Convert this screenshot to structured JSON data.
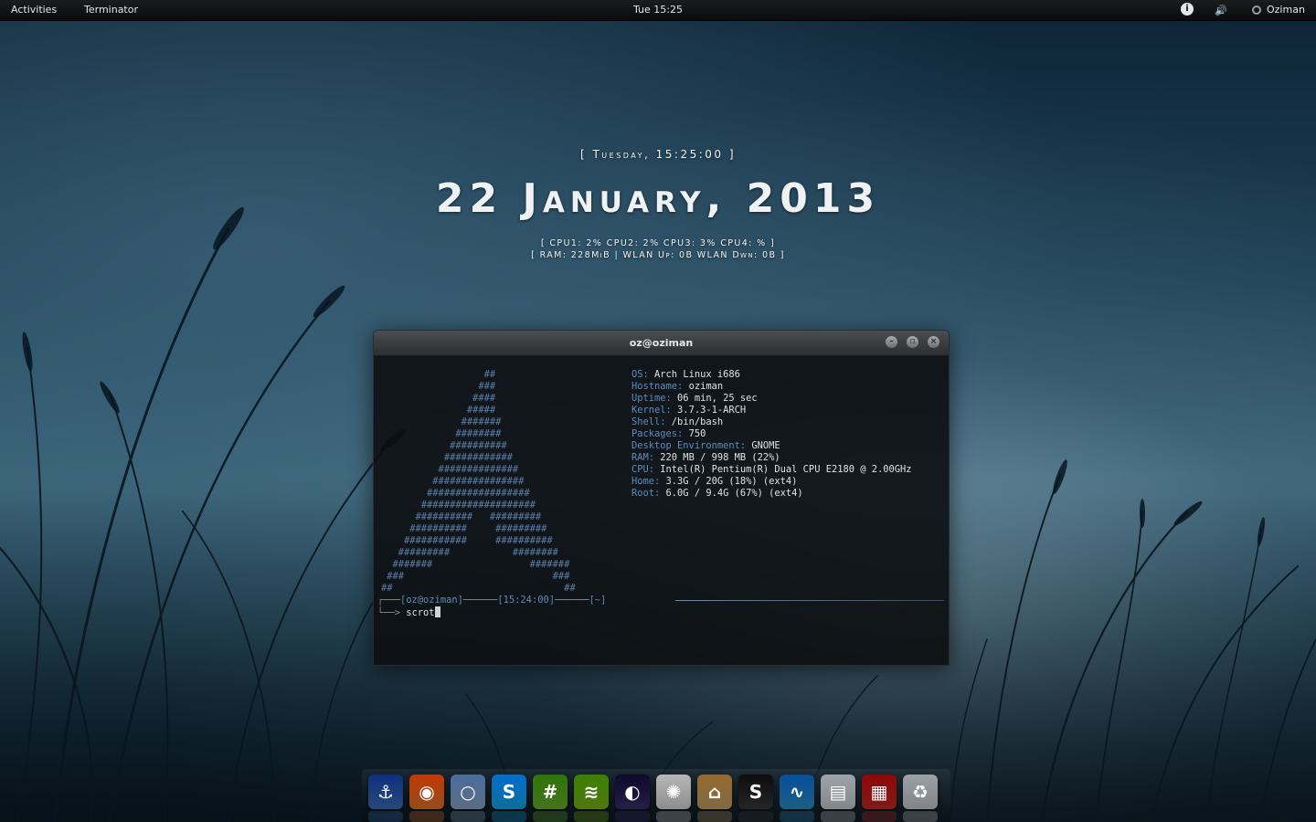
{
  "topbar": {
    "activities": "Activities",
    "app_name": "Terminator",
    "clock": "Tue 15:25",
    "accessibility_glyph": "i",
    "volume_glyph": "🔊",
    "user_name": "Oziman"
  },
  "conky": {
    "day_line": "[ Tuesday, 15:25:00 ]",
    "date_line": "22 January, 2013",
    "cpu_line": "[ CPU1: 2% CPU2: 2% CPU3: 3% CPU4: % ]",
    "net_line": "[ RAM: 228MiB | WLAN Up: 0B    WLAN Dwn: 0B   ]"
  },
  "terminal": {
    "title": "oz@oziman",
    "buttons": {
      "minimize": "–",
      "maximize": "▫",
      "close": "×"
    },
    "logo": "                  ##\n                 ###\n                ####\n               #####\n              #######\n             ########\n            ##########\n           ############\n          ##############\n         ################\n        ##################\n       ####################\n      ##########   #########\n     ##########     #########\n    ###########     ##########\n   #########           ########\n  #######                 #######\n ###                          ###\n##                              ##",
    "info": [
      {
        "key": "OS:",
        "value": " Arch Linux i686"
      },
      {
        "key": "Hostname:",
        "value": " oziman"
      },
      {
        "key": "Uptime:",
        "value": " 06 min, 25 sec"
      },
      {
        "key": "Kernel:",
        "value": " 3.7.3-1-ARCH"
      },
      {
        "key": "Shell:",
        "value": " /bin/bash"
      },
      {
        "key": "Packages:",
        "value": " 750"
      },
      {
        "key": "Desktop Environment:",
        "value": " GNOME"
      },
      {
        "key": "RAM:",
        "value": " 220 MB / 998 MB (22%)"
      },
      {
        "key": "CPU:",
        "value": " Intel(R) Pentium(R) Dual CPU E2180 @ 2.00GHz"
      },
      {
        "key": "Home:",
        "value": " 3.3G / 20G (18%) (ext4)"
      },
      {
        "key": "Root:",
        "value": " 6.0G / 9.4G (67%) (ext4)"
      }
    ],
    "prompt": {
      "corner_top": "┌───",
      "user_host": "[oz@oziman]",
      "sep1": "──────",
      "time": "[15:24:00]",
      "sep2": "──────",
      "dir": "[~]",
      "corner_bottom": "└──> ",
      "command": "scrot"
    }
  },
  "dock": {
    "items": [
      {
        "name": "anchor",
        "glyph": "⚓",
        "color": "#3c6fb6"
      },
      {
        "name": "firefox",
        "glyph": "◉",
        "color": "#e0772a"
      },
      {
        "name": "chromium",
        "glyph": "○",
        "color": "#8aa7c8"
      },
      {
        "name": "skype",
        "glyph": "S",
        "color": "#17a8e6"
      },
      {
        "name": "hexchat",
        "glyph": "#",
        "color": "#6cae2d"
      },
      {
        "name": "spotify",
        "glyph": "≋",
        "color": "#7cb518"
      },
      {
        "name": "eclipse",
        "glyph": "◐",
        "color": "#3b2f6b"
      },
      {
        "name": "help",
        "glyph": "✺",
        "color": "#d8d8d8"
      },
      {
        "name": "home-folder",
        "glyph": "⌂",
        "color": "#c4a46b"
      },
      {
        "name": "sublime-text",
        "glyph": "S",
        "color": "#3a3a3a"
      },
      {
        "name": "system-monitor",
        "glyph": "∿",
        "color": "#2a8fc7"
      },
      {
        "name": "file-cabinet",
        "glyph": "▤",
        "color": "#c9cdd1"
      },
      {
        "name": "workspaces",
        "glyph": "▦",
        "color": "#c02a2a"
      },
      {
        "name": "trash",
        "glyph": "♻",
        "color": "#c7cbce"
      }
    ]
  }
}
